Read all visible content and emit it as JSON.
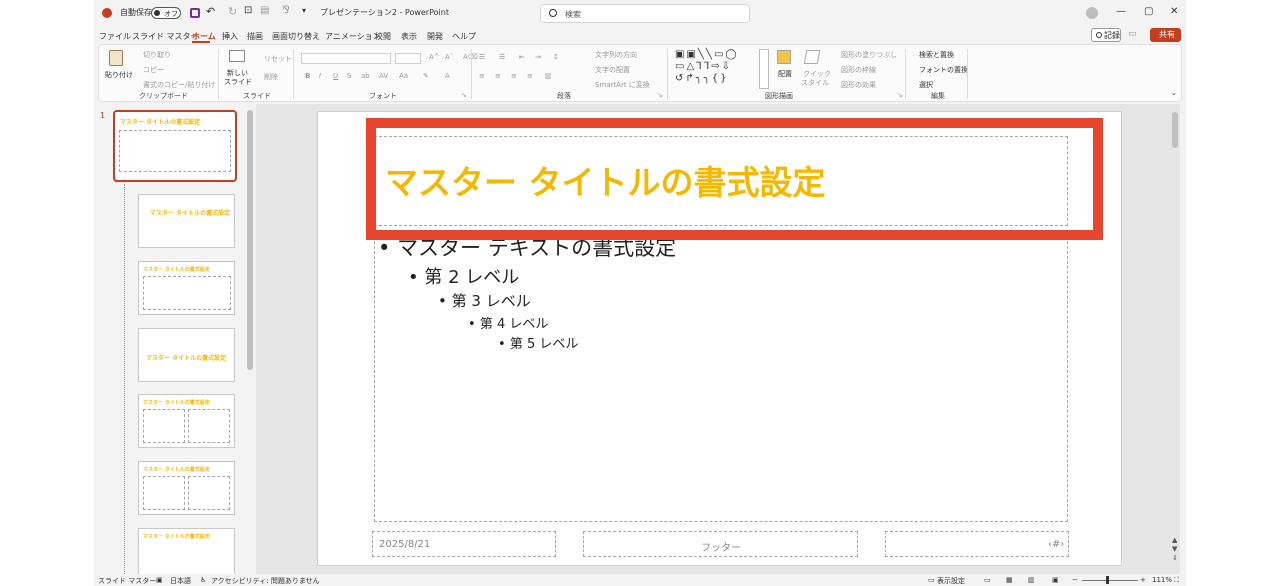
{
  "titlebar": {
    "autosave_label": "自動保存",
    "autosave_state": "オフ",
    "doc_title": "プレゼンテーション2 - PowerPoint",
    "search_placeholder": "検索"
  },
  "tabs": [
    "ファイル",
    "スライド マスター",
    "ホーム",
    "挿入",
    "描画",
    "画面切り替え",
    "アニメーション",
    "校閲",
    "表示",
    "開発",
    "ヘルプ"
  ],
  "active_tab": "ホーム",
  "record_label": "記録",
  "share_label": "共有",
  "ribbon": {
    "clipboard": {
      "paste": "貼り付け",
      "cut": "切り取り",
      "copy": "コピー",
      "format_painter": "書式のコピー/貼り付け",
      "group": "クリップボード"
    },
    "slides": {
      "new_slide_1": "新しい",
      "new_slide_2": "スライド",
      "reset": "リセット",
      "delete": "削除",
      "group": "スライド"
    },
    "font": {
      "group": "フォント"
    },
    "paragraph": {
      "text_direction": "文字列の方向",
      "align_text": "文字の配置",
      "smartart": "SmartArt に変換",
      "group": "段落"
    },
    "drawing": {
      "arrange": "配置",
      "quick_styles_1": "クイック",
      "quick_styles_2": "スタイル",
      "fill": "図形の塗りつぶし",
      "outline": "図形の枠線",
      "effects": "図形の効果",
      "group": "図形描画"
    },
    "editing": {
      "find": "検索と置換",
      "replace_font": "フォントの置換",
      "select": "選択",
      "group": "編集"
    }
  },
  "slide_panel": {
    "selected_number": "1",
    "thumb_titles": [
      "マスター タイトルの書式設定",
      "マスター タイトルの書式設定",
      "マスター タイトルの書式設定",
      "マスター タイトルの書式設定",
      "マスター タイトルの書式設定",
      "マスター タイトルの書式設定",
      "マスター タイトルの書式設定"
    ]
  },
  "slide": {
    "title": "マスター タイトルの書式設定",
    "level1": "マスター テキストの書式設定",
    "level2": "第 2 レベル",
    "level3": "第 3 レベル",
    "level4": "第 4 レベル",
    "level5": "第 5 レベル",
    "date": "2025/8/21",
    "footer": "フッター",
    "page_number": "‹#›"
  },
  "status": {
    "view": "スライド マスター",
    "language": "日本語",
    "accessibility": "アクセシビリティ: 問題ありません",
    "display_settings": "表示設定",
    "zoom": "111%"
  },
  "colors": {
    "accent": "#c43e1c",
    "title_color": "#f5b800",
    "highlight_box": "#e8452f"
  }
}
